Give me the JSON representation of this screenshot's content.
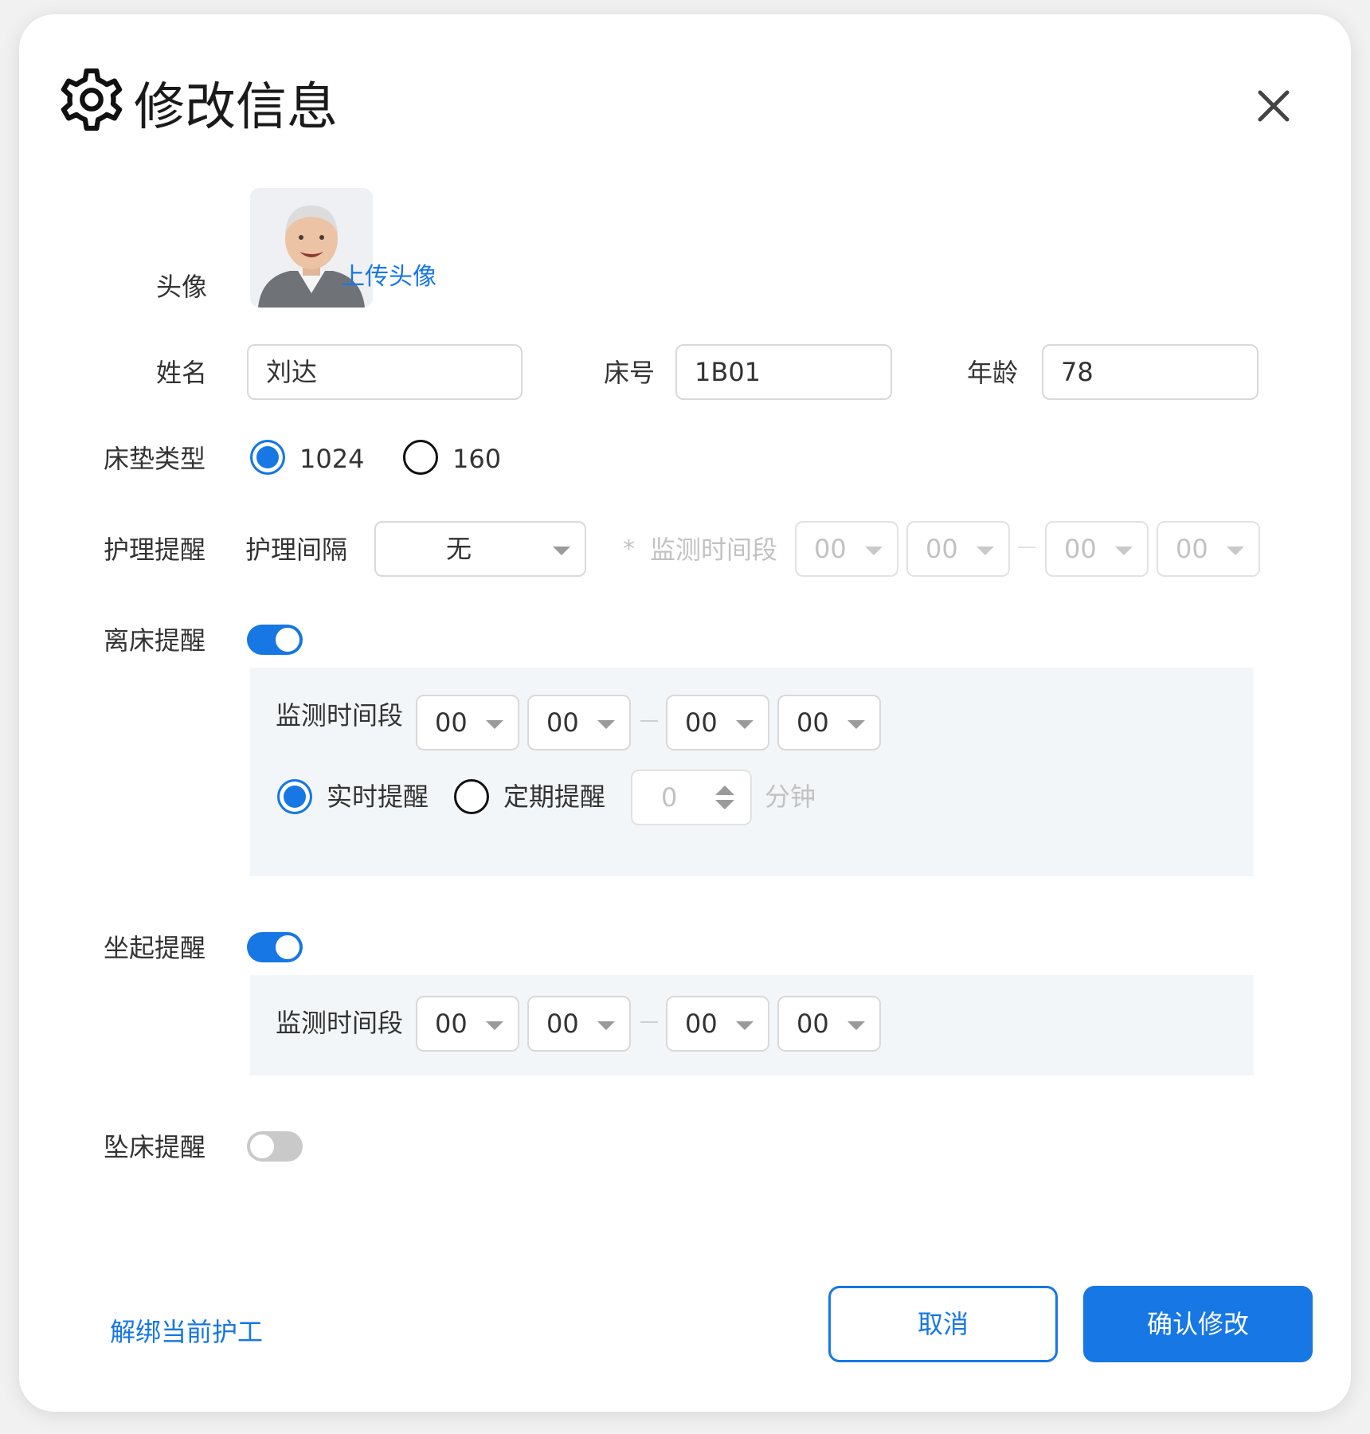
{
  "dialog": {
    "title": "修改信息",
    "icons": {
      "title": "gear-icon",
      "close": "close-icon"
    }
  },
  "avatar": {
    "label": "头像",
    "upload_link": "上传头像"
  },
  "name": {
    "label": "姓名",
    "value": "刘达"
  },
  "bed": {
    "label": "床号",
    "value": "1B01"
  },
  "age": {
    "label": "年龄",
    "value": "78"
  },
  "mattress": {
    "label": "床垫类型",
    "options": [
      {
        "label": "1024",
        "selected": true
      },
      {
        "label": "160",
        "selected": false
      }
    ]
  },
  "care_reminder": {
    "label": "护理提醒",
    "interval_label": "护理间隔",
    "interval_value": "无",
    "required_mark": "*",
    "period_label": "监测时间段",
    "times": [
      "00",
      "00",
      "00",
      "00"
    ]
  },
  "leave_bed": {
    "label": "离床提醒",
    "enabled": true,
    "period_label": "监测时间段",
    "times": [
      "00",
      "00",
      "00",
      "00"
    ],
    "realtime_label": "实时提醒",
    "periodic_label": "定期提醒",
    "realtime_selected": true,
    "minutes_value": "0",
    "minutes_unit": "分钟"
  },
  "sit_up": {
    "label": "坐起提醒",
    "enabled": true,
    "period_label": "监测时间段",
    "times": [
      "00",
      "00",
      "00",
      "00"
    ]
  },
  "fall_bed": {
    "label": "坠床提醒",
    "enabled": false
  },
  "footer": {
    "unbind_link": "解绑当前护工",
    "cancel_label": "取消",
    "confirm_label": "确认修改"
  },
  "colors": {
    "primary": "#1677e5",
    "panel": "#f3f6f9",
    "disabled_text": "#c2c2c2"
  }
}
